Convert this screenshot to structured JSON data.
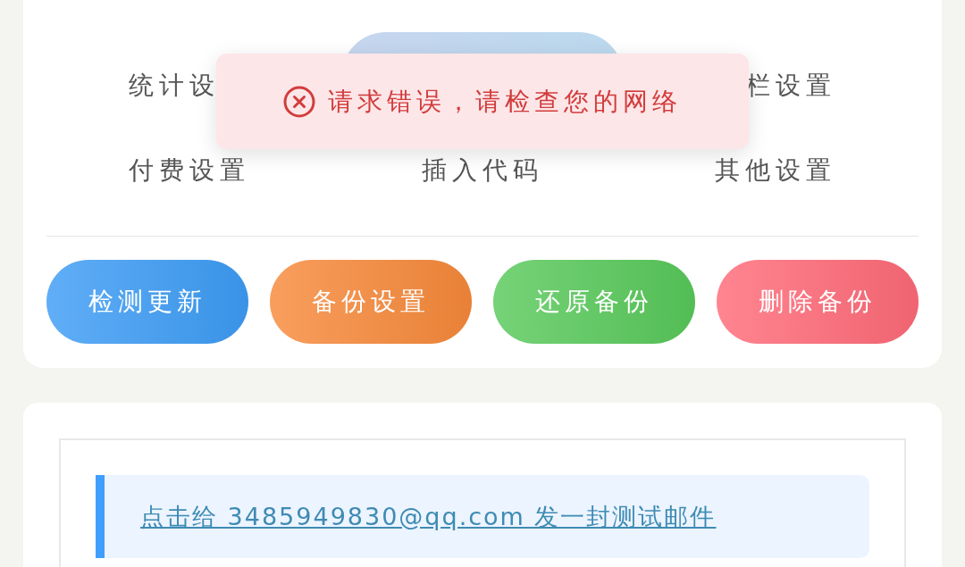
{
  "settings_grid": [
    {
      "label": "统计设",
      "selected": false
    },
    {
      "selected": true
    },
    {
      "label": "栏设置",
      "selected": false
    },
    {
      "label": "付费设置",
      "selected": false
    },
    {
      "label": "插入代码",
      "selected": false
    },
    {
      "label": "其他设置",
      "selected": false
    }
  ],
  "action_buttons": [
    {
      "label": "检测更新",
      "color": "#3d9cf5"
    },
    {
      "label": "备份设置",
      "color": "#f7893a"
    },
    {
      "label": "还原备份",
      "color": "#58c95a"
    },
    {
      "label": "删除备份",
      "color": "#ff6a78"
    }
  ],
  "test_mail_link": "点击给 3485949830@qq.com 发一封测试邮件",
  "toast": {
    "kind": "error",
    "message": "请求错误，请检查您的网络"
  }
}
